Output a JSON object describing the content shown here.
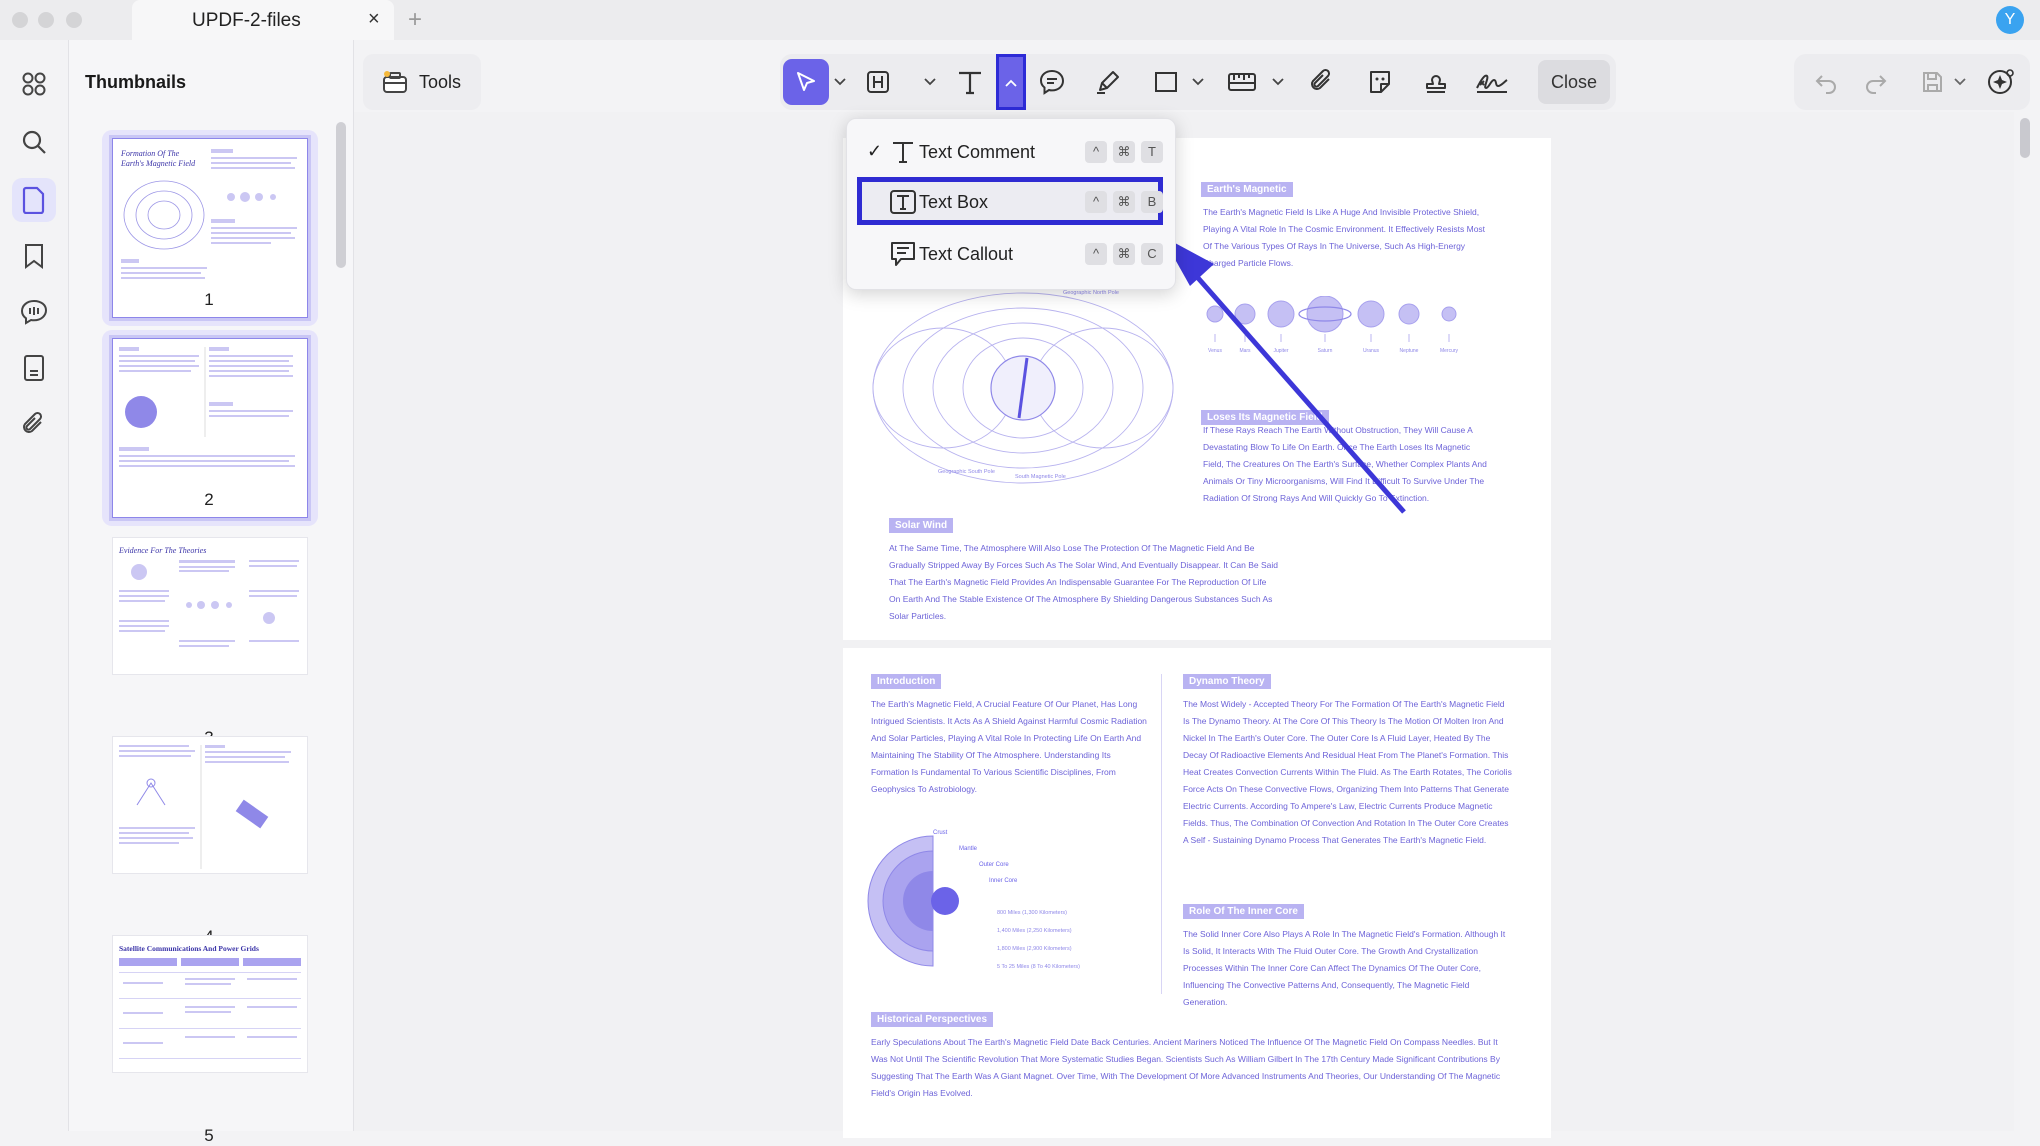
{
  "window": {
    "tab_title": "UPDF-2-files",
    "tab_close": "×",
    "tab_add": "+",
    "avatar_initial": "Y"
  },
  "left_rail": {
    "items": [
      "grid-icon",
      "search-icon",
      "pages-icon",
      "bookmark-icon",
      "comment-icon",
      "document-icon",
      "attachment-icon"
    ],
    "active": "pages-icon"
  },
  "thumbnails": {
    "title": "Thumbnails",
    "pages": [
      {
        "num": "1",
        "heading": "Formation Of The Earth's Magnetic Field"
      },
      {
        "num": "2",
        "heading": ""
      },
      {
        "num": "3",
        "heading": "Evidence For The Theories"
      },
      {
        "num": "4",
        "heading": ""
      },
      {
        "num": "5",
        "heading": "Satellite Communications And Power Grids"
      }
    ],
    "selected": [
      "1",
      "2"
    ]
  },
  "toolbar": {
    "tools_label": "Tools",
    "close_label": "Close",
    "active_tool": "select",
    "icons": [
      "select-icon",
      "highlight-icon",
      "text-icon",
      "comment-icon",
      "pen-icon",
      "rectangle-icon",
      "measure-icon",
      "attachment-icon",
      "sticker-icon",
      "stamp-icon",
      "signature-icon"
    ],
    "right_icons": [
      "undo-icon",
      "redo-icon",
      "save-icon",
      "ai-assistant-icon"
    ],
    "accent": "#6b63e8"
  },
  "text_menu": {
    "items": [
      {
        "label": "Text Comment",
        "checked": "✓",
        "keys": [
          "^",
          "⌘",
          "T"
        ]
      },
      {
        "label": "Text Box",
        "checked": "",
        "keys": [
          "^",
          "⌘",
          "B"
        ]
      },
      {
        "label": "Text Callout",
        "checked": "",
        "keys": [
          "^",
          "⌘",
          "C"
        ]
      }
    ],
    "highlighted": "Text Box",
    "highlight_color": "#2f2bd2"
  },
  "document": {
    "page1": {
      "tag_magnetic": "Earth's Magnetic",
      "magnetic_text": "The Earth's Magnetic Field Is Like A Huge And Invisible Protective Shield, Playing A Vital Role In The Cosmic Environment. It Effectively Resists Most Of The Various Types Of Rays In The Universe, Such As High-Energy Charged Particle Flows.",
      "tag_loses": "Loses Its Magnetic Field",
      "loses_text": "If These Rays Reach The Earth Without Obstruction, They Will Cause A Devastating Blow To Life On Earth. Once The Earth Loses Its Magnetic Field, The Creatures On The Earth's Surface, Whether Complex Plants And Animals Or Tiny Microorganisms, Will Find It Difficult To Survive Under The Radiation Of Strong Rays And Will Quickly Go To Extinction.",
      "tag_solar": "Solar Wind",
      "solar_text": "At The Same Time, The Atmosphere Will Also Lose The Protection Of The Magnetic Field And Be Gradually Stripped Away By Forces Such As The Solar Wind, And Eventually Disappear. It Can Be Said That The Earth's Magnetic Field Provides An Indispensable Guarantee For The Reproduction Of Life On Earth And The Stable Existence Of The Atmosphere By Shielding Dangerous Substances Such As Solar Particles.",
      "diagram_labels": {
        "north": "Geographic North Pole",
        "south": "Geographic South Pole",
        "south_mag": "South Magnetic Pole"
      },
      "planets": [
        "Venus",
        "Mars",
        "Jupiter",
        "Saturn",
        "Uranus",
        "Neptune",
        "Mercury"
      ]
    },
    "page2": {
      "tag_intro": "Introduction",
      "intro_text": "The Earth's Magnetic Field, A Crucial Feature Of Our Planet, Has Long Intrigued Scientists. It Acts As A Shield Against Harmful Cosmic Radiation And Solar Particles, Playing A Vital Role In Protecting Life On Earth And Maintaining The Stability Of The Atmosphere. Understanding Its Formation Is Fundamental To Various Scientific Disciplines, From Geophysics To Astrobiology.",
      "tag_dynamo": "Dynamo Theory",
      "dynamo_text": "The Most Widely - Accepted Theory For The Formation Of The Earth's Magnetic Field Is The Dynamo Theory. At The Core Of This Theory Is The Motion Of Molten Iron And Nickel In The Earth's Outer Core. The Outer Core Is A Fluid Layer, Heated By The Decay Of Radioactive Elements And Residual Heat From The Planet's Formation. This Heat Creates Convection Currents Within The Fluid. As The Earth Rotates, The Coriolis Force Acts On These Convective Flows, Organizing Them Into Patterns That Generate Electric Currents. According To Ampere's Law, Electric Currents Produce Magnetic Fields. Thus, The Combination Of Convection And Rotation In The Outer Core Creates A Self - Sustaining Dynamo Process That Generates The Earth's Magnetic Field.",
      "tag_inner": "Role Of The Inner Core",
      "inner_text": "The Solid Inner Core Also Plays A Role In The Magnetic Field's Formation. Although It Is Solid, It Interacts With The Fluid Outer Core. The Growth And Crystallization Processes Within The Inner Core Can Affect The Dynamics Of The Outer Core, Influencing The Convective Patterns And, Consequently, The Magnetic Field Generation.",
      "tag_hist": "Historical Perspectives",
      "hist_text": "Early Speculations About The Earth's Magnetic Field Date Back Centuries. Ancient Mariners Noticed The Influence Of The Magnetic Field On Compass Needles. But It Was Not Until The Scientific Revolution That More Systematic Studies Began. Scientists Such As William Gilbert In The 17th Century Made Significant Contributions By Suggesting That The Earth Was A Giant Magnet. Over Time, With The Development Of More Advanced Instruments And Theories, Our Understanding Of The Magnetic Field's Origin Has Evolved.",
      "layers": [
        "Crust",
        "Mantle",
        "Outer Core",
        "Inner Core"
      ],
      "depths": [
        "800 Miles (1,300 Kilometers)",
        "1,400 Miles (2,250 Kilometers)",
        "1,800 Miles (2,900 Kilometers)",
        "5 To 25 Miles (8 To 40 Kilometers)"
      ]
    }
  }
}
